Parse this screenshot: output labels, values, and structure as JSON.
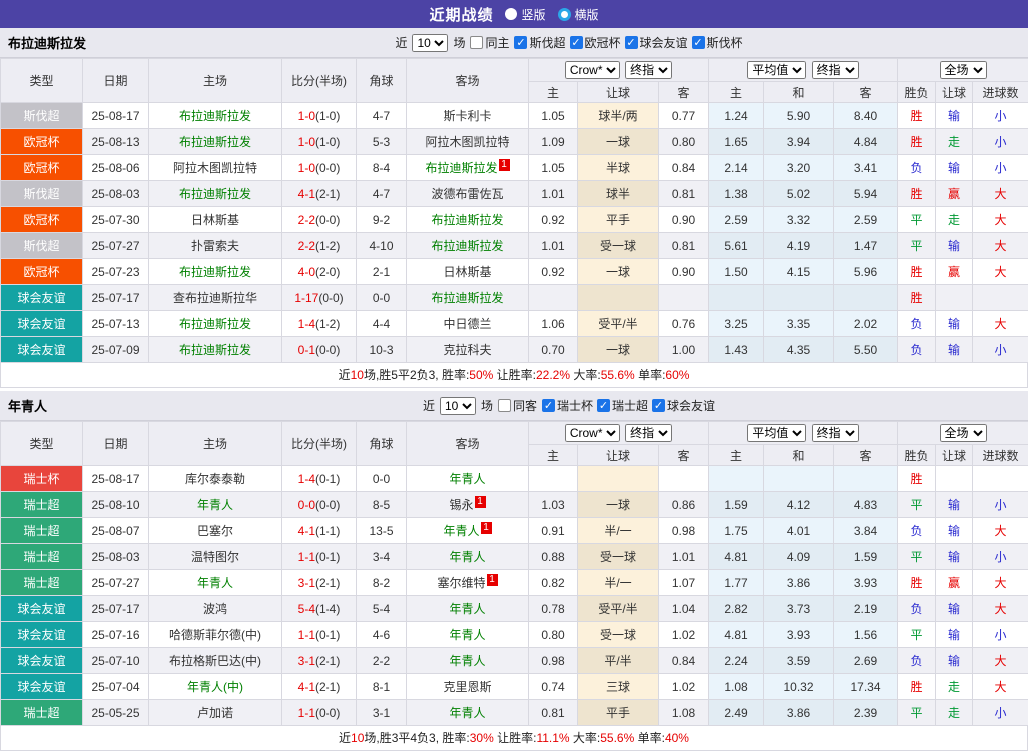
{
  "topbar": {
    "title": "近期战绩",
    "radios": [
      {
        "label": "竖版",
        "selected": false
      },
      {
        "label": "横版",
        "selected": true
      }
    ]
  },
  "thead": {
    "cols": [
      "类型",
      "日期",
      "主场",
      "比分(半场)",
      "角球",
      "客场"
    ],
    "selects": {
      "crow": "Crow*",
      "final1": "终指",
      "avg": "平均值",
      "final2": "终指",
      "full": "全场"
    },
    "sub": [
      "主",
      "让球",
      "客",
      "主",
      "和",
      "客",
      "胜负",
      "让球",
      "进球数"
    ]
  },
  "league_colors": {
    "斯伐超": "#c3c2c8",
    "欧冠杯": "#f75000",
    "球会友谊": "#14a3a3",
    "瑞士杯": "#e8453c",
    "瑞士超": "#2ea878"
  },
  "result_colors": {
    "胜": "#e60000",
    "赢": "#e60000",
    "大": "#e60000",
    "平": "#009933",
    "走": "#009933",
    "负": "#2a2ad0",
    "输": "#2a2ad0",
    "小": "#2a2ad0"
  },
  "sections": [
    {
      "team": "布拉迪斯拉发",
      "controls": {
        "near": "近",
        "count": "10",
        "games": "场",
        "scope": "同主",
        "scope_checked": false,
        "leagues": [
          "斯伐超",
          "欧冠杯",
          "球会友谊",
          "斯伐杯"
        ]
      },
      "rows": [
        {
          "league": "斯伐超",
          "date": "25-08-17",
          "home": "布拉迪斯拉发",
          "home_self": true,
          "home_rc": false,
          "score": "1-0",
          "half": "(1-0)",
          "corners": "4-7",
          "away": "斯卡利卡",
          "away_self": false,
          "away_rc": false,
          "crow": [
            "1.05",
            "球半/两",
            "0.77"
          ],
          "avg": [
            "1.24",
            "5.90",
            "8.40"
          ],
          "result": [
            "胜",
            "输",
            "小"
          ]
        },
        {
          "league": "欧冠杯",
          "date": "25-08-13",
          "home": "布拉迪斯拉发",
          "home_self": true,
          "home_rc": false,
          "score": "1-0",
          "half": "(1-0)",
          "corners": "5-3",
          "away": "阿拉木图凯拉特",
          "away_self": false,
          "away_rc": false,
          "crow": [
            "1.09",
            "一球",
            "0.80"
          ],
          "avg": [
            "1.65",
            "3.94",
            "4.84"
          ],
          "result": [
            "胜",
            "走",
            "小"
          ]
        },
        {
          "league": "欧冠杯",
          "date": "25-08-06",
          "home": "阿拉木图凯拉特",
          "home_self": false,
          "home_rc": false,
          "score": "1-0",
          "half": "(0-0)",
          "corners": "8-4",
          "away": "布拉迪斯拉发",
          "away_self": true,
          "away_rc": true,
          "crow": [
            "1.05",
            "半球",
            "0.84"
          ],
          "avg": [
            "2.14",
            "3.20",
            "3.41"
          ],
          "result": [
            "负",
            "输",
            "小"
          ]
        },
        {
          "league": "斯伐超",
          "date": "25-08-03",
          "home": "布拉迪斯拉发",
          "home_self": true,
          "home_rc": false,
          "score": "4-1",
          "half": "(2-1)",
          "corners": "4-7",
          "away": "波德布雷佐瓦",
          "away_self": false,
          "away_rc": false,
          "crow": [
            "1.01",
            "球半",
            "0.81"
          ],
          "avg": [
            "1.38",
            "5.02",
            "5.94"
          ],
          "result": [
            "胜",
            "赢",
            "大"
          ]
        },
        {
          "league": "欧冠杯",
          "date": "25-07-30",
          "home": "日林斯基",
          "home_self": false,
          "home_rc": false,
          "score": "2-2",
          "half": "(0-0)",
          "corners": "9-2",
          "away": "布拉迪斯拉发",
          "away_self": true,
          "away_rc": false,
          "crow": [
            "0.92",
            "平手",
            "0.90"
          ],
          "avg": [
            "2.59",
            "3.32",
            "2.59"
          ],
          "result": [
            "平",
            "走",
            "大"
          ]
        },
        {
          "league": "斯伐超",
          "date": "25-07-27",
          "home": "扑雷索夫",
          "home_self": false,
          "home_rc": false,
          "score": "2-2",
          "half": "(1-2)",
          "corners": "4-10",
          "away": "布拉迪斯拉发",
          "away_self": true,
          "away_rc": false,
          "crow": [
            "1.01",
            "受一球",
            "0.81"
          ],
          "avg": [
            "5.61",
            "4.19",
            "1.47"
          ],
          "result": [
            "平",
            "输",
            "大"
          ]
        },
        {
          "league": "欧冠杯",
          "date": "25-07-23",
          "home": "布拉迪斯拉发",
          "home_self": true,
          "home_rc": false,
          "score": "4-0",
          "half": "(2-0)",
          "corners": "2-1",
          "away": "日林斯基",
          "away_self": false,
          "away_rc": false,
          "crow": [
            "0.92",
            "一球",
            "0.90"
          ],
          "avg": [
            "1.50",
            "4.15",
            "5.96"
          ],
          "result": [
            "胜",
            "赢",
            "大"
          ]
        },
        {
          "league": "球会友谊",
          "date": "25-07-17",
          "home": "查布拉迪斯拉华",
          "home_self": false,
          "home_rc": false,
          "score": "1-17",
          "half": "(0-0)",
          "corners": "0-0",
          "away": "布拉迪斯拉发",
          "away_self": true,
          "away_rc": false,
          "crow": [
            "",
            "",
            ""
          ],
          "avg": [
            "",
            "",
            ""
          ],
          "result": [
            "胜",
            "",
            ""
          ]
        },
        {
          "league": "球会友谊",
          "date": "25-07-13",
          "home": "布拉迪斯拉发",
          "home_self": true,
          "home_rc": false,
          "score": "1-4",
          "half": "(1-2)",
          "corners": "4-4",
          "away": "中日德兰",
          "away_self": false,
          "away_rc": false,
          "crow": [
            "1.06",
            "受平/半",
            "0.76"
          ],
          "avg": [
            "3.25",
            "3.35",
            "2.02"
          ],
          "result": [
            "负",
            "输",
            "大"
          ]
        },
        {
          "league": "球会友谊",
          "date": "25-07-09",
          "home": "布拉迪斯拉发",
          "home_self": true,
          "home_rc": false,
          "score": "0-1",
          "half": "(0-0)",
          "corners": "10-3",
          "away": "克拉科夫",
          "away_self": false,
          "away_rc": false,
          "crow": [
            "0.70",
            "一球",
            "1.00"
          ],
          "avg": [
            "1.43",
            "4.35",
            "5.50"
          ],
          "result": [
            "负",
            "输",
            "小"
          ]
        }
      ],
      "summary": [
        {
          "t": "近",
          "red": false
        },
        {
          "t": "10",
          "red": true
        },
        {
          "t": "场,胜5平2负3, 胜率:",
          "red": false
        },
        {
          "t": "50%",
          "red": true
        },
        {
          "t": " 让胜率:",
          "red": false
        },
        {
          "t": "22.2%",
          "red": true
        },
        {
          "t": " 大率:",
          "red": false
        },
        {
          "t": "55.6%",
          "red": true
        },
        {
          "t": " 单率:",
          "red": false
        },
        {
          "t": "60%",
          "red": true
        }
      ]
    },
    {
      "team": "年青人",
      "controls": {
        "near": "近",
        "count": "10",
        "games": "场",
        "scope": "同客",
        "scope_checked": false,
        "leagues": [
          "瑞士杯",
          "瑞士超",
          "球会友谊"
        ]
      },
      "rows": [
        {
          "league": "瑞士杯",
          "date": "25-08-17",
          "home": "库尔泰泰勒",
          "home_self": false,
          "home_rc": false,
          "score": "1-4",
          "half": "(0-1)",
          "corners": "0-0",
          "away": "年青人",
          "away_self": true,
          "away_rc": false,
          "crow": [
            "",
            "",
            ""
          ],
          "avg": [
            "",
            "",
            ""
          ],
          "result": [
            "胜",
            "",
            ""
          ]
        },
        {
          "league": "瑞士超",
          "date": "25-08-10",
          "home": "年青人",
          "home_self": true,
          "home_rc": false,
          "score": "0-0",
          "half": "(0-0)",
          "corners": "8-5",
          "away": "锡永",
          "away_self": false,
          "away_rc": true,
          "crow": [
            "1.03",
            "一球",
            "0.86"
          ],
          "avg": [
            "1.59",
            "4.12",
            "4.83"
          ],
          "result": [
            "平",
            "输",
            "小"
          ]
        },
        {
          "league": "瑞士超",
          "date": "25-08-07",
          "home": "巴塞尔",
          "home_self": false,
          "home_rc": false,
          "score": "4-1",
          "half": "(1-1)",
          "corners": "13-5",
          "away": "年青人",
          "away_self": true,
          "away_rc": true,
          "crow": [
            "0.91",
            "半/一",
            "0.98"
          ],
          "avg": [
            "1.75",
            "4.01",
            "3.84"
          ],
          "result": [
            "负",
            "输",
            "大"
          ]
        },
        {
          "league": "瑞士超",
          "date": "25-08-03",
          "home": "温特图尔",
          "home_self": false,
          "home_rc": false,
          "score": "1-1",
          "half": "(0-1)",
          "corners": "3-4",
          "away": "年青人",
          "away_self": true,
          "away_rc": false,
          "crow": [
            "0.88",
            "受一球",
            "1.01"
          ],
          "avg": [
            "4.81",
            "4.09",
            "1.59"
          ],
          "result": [
            "平",
            "输",
            "小"
          ]
        },
        {
          "league": "瑞士超",
          "date": "25-07-27",
          "home": "年青人",
          "home_self": true,
          "home_rc": false,
          "score": "3-1",
          "half": "(2-1)",
          "corners": "8-2",
          "away": "塞尔维特",
          "away_self": false,
          "away_rc": true,
          "crow": [
            "0.82",
            "半/一",
            "1.07"
          ],
          "avg": [
            "1.77",
            "3.86",
            "3.93"
          ],
          "result": [
            "胜",
            "赢",
            "大"
          ]
        },
        {
          "league": "球会友谊",
          "date": "25-07-17",
          "home": "波鸿",
          "home_self": false,
          "home_rc": false,
          "score": "5-4",
          "half": "(1-4)",
          "corners": "5-4",
          "away": "年青人",
          "away_self": true,
          "away_rc": false,
          "crow": [
            "0.78",
            "受平/半",
            "1.04"
          ],
          "avg": [
            "2.82",
            "3.73",
            "2.19"
          ],
          "result": [
            "负",
            "输",
            "大"
          ]
        },
        {
          "league": "球会友谊",
          "date": "25-07-16",
          "home": "哈德斯菲尔德(中)",
          "home_self": false,
          "home_rc": false,
          "score": "1-1",
          "half": "(0-1)",
          "corners": "4-6",
          "away": "年青人",
          "away_self": true,
          "away_rc": false,
          "crow": [
            "0.80",
            "受一球",
            "1.02"
          ],
          "avg": [
            "4.81",
            "3.93",
            "1.56"
          ],
          "result": [
            "平",
            "输",
            "小"
          ]
        },
        {
          "league": "球会友谊",
          "date": "25-07-10",
          "home": "布拉格斯巴达(中)",
          "home_self": false,
          "home_rc": false,
          "score": "3-1",
          "half": "(2-1)",
          "corners": "2-2",
          "away": "年青人",
          "away_self": true,
          "away_rc": false,
          "crow": [
            "0.98",
            "平/半",
            "0.84"
          ],
          "avg": [
            "2.24",
            "3.59",
            "2.69"
          ],
          "result": [
            "负",
            "输",
            "大"
          ]
        },
        {
          "league": "球会友谊",
          "date": "25-07-04",
          "home": "年青人(中)",
          "home_self": true,
          "home_rc": false,
          "score": "4-1",
          "half": "(2-1)",
          "corners": "8-1",
          "away": "克里恩斯",
          "away_self": false,
          "away_rc": false,
          "crow": [
            "0.74",
            "三球",
            "1.02"
          ],
          "avg": [
            "1.08",
            "10.32",
            "17.34"
          ],
          "result": [
            "胜",
            "走",
            "大"
          ]
        },
        {
          "league": "瑞士超",
          "date": "25-05-25",
          "home": "卢加诺",
          "home_self": false,
          "home_rc": false,
          "score": "1-1",
          "half": "(0-0)",
          "corners": "3-1",
          "away": "年青人",
          "away_self": true,
          "away_rc": false,
          "crow": [
            "0.81",
            "平手",
            "1.08"
          ],
          "avg": [
            "2.49",
            "3.86",
            "2.39"
          ],
          "result": [
            "平",
            "走",
            "小"
          ]
        }
      ],
      "summary": [
        {
          "t": "近",
          "red": false
        },
        {
          "t": "10",
          "red": true
        },
        {
          "t": "场,胜3平4负3, 胜率:",
          "red": false
        },
        {
          "t": "30%",
          "red": true
        },
        {
          "t": " 让胜率:",
          "red": false
        },
        {
          "t": "11.1%",
          "red": true
        },
        {
          "t": " 大率:",
          "red": false
        },
        {
          "t": "55.6%",
          "red": true
        },
        {
          "t": " 单率:",
          "red": false
        },
        {
          "t": "40%",
          "red": true
        }
      ]
    }
  ]
}
